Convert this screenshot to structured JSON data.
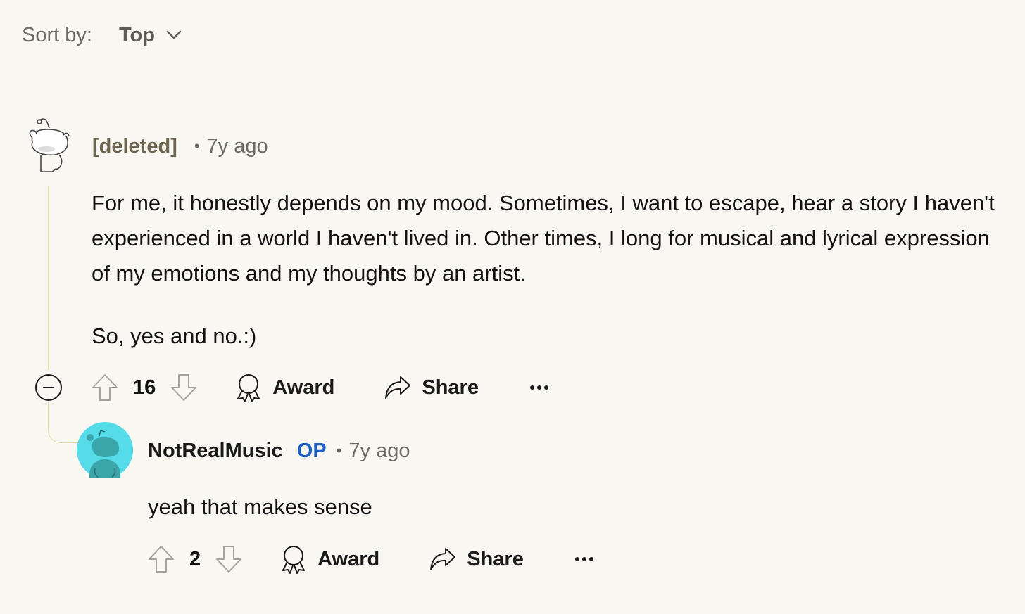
{
  "sort": {
    "label": "Sort by:",
    "value": "Top"
  },
  "comments": [
    {
      "author": "[deleted]",
      "time": "7y ago",
      "paragraphs": [
        "For me, it honestly depends on my mood. Sometimes, I want to escape, hear a story I haven't experienced in a world I haven't lived in. Other times, I long for musical and lyrical expression of my emotions and my thoughts by an artist.",
        "So, yes and no.:)"
      ],
      "votes": "16",
      "award_label": "Award",
      "share_label": "Share"
    },
    {
      "author": "NotRealMusic",
      "badge": "OP",
      "time": "7y ago",
      "paragraphs": [
        "yeah that makes sense"
      ],
      "votes": "2",
      "award_label": "Award",
      "share_label": "Share"
    }
  ],
  "colors": {
    "background": "#f9f7f2",
    "op_badge": "#1f5fc2",
    "op_avatar": "#55dce8",
    "thread_line": "#e6d9a8"
  },
  "icons": [
    "chevron-down-icon",
    "upvote-icon",
    "downvote-icon",
    "award-icon",
    "share-icon",
    "more-icon",
    "collapse-icon"
  ]
}
